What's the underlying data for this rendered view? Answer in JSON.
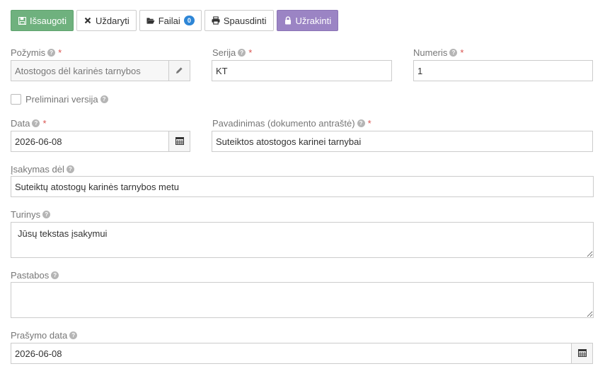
{
  "toolbar": {
    "save_label": "Išsaugoti",
    "close_label": "Uždaryti",
    "files_label": "Failai",
    "files_count": "0",
    "print_label": "Spausdinti",
    "lock_label": "Užrakinti"
  },
  "form": {
    "pozymis": {
      "label": "Požymis",
      "value": "Atostogos dėl karinės tarnybos"
    },
    "serija": {
      "label": "Serija",
      "value": "KT"
    },
    "numeris": {
      "label": "Numeris",
      "value": "1"
    },
    "preliminari": {
      "label": "Preliminari versija",
      "checked": false
    },
    "data": {
      "label": "Data",
      "value": "2026-06-08"
    },
    "pavadinimas": {
      "label": "Pavadinimas (dokumento antraštė)",
      "value": "Suteiktos atostogos karinei tarnybai"
    },
    "isakymas_del": {
      "label": "Įsakymas dėl",
      "value": "Suteiktų atostogų karinės tarnybos metu"
    },
    "turinys": {
      "label": "Turinys",
      "value": "Jūsų tekstas įsakymui"
    },
    "pastabos": {
      "label": "Pastabos",
      "value": ""
    },
    "prasymo_data": {
      "label": "Prašymo data",
      "value": "2026-06-08"
    }
  },
  "help_glyph": "?",
  "required_mark": "*",
  "colors": {
    "save": "#6fb17e",
    "lock": "#9b84c4",
    "badge": "#2e86d6",
    "required": "#d9534f"
  },
  "icons": [
    "save-icon",
    "close-icon",
    "folder-open-icon",
    "print-icon",
    "lock-icon",
    "pencil-icon",
    "calendar-icon",
    "help-icon"
  ]
}
